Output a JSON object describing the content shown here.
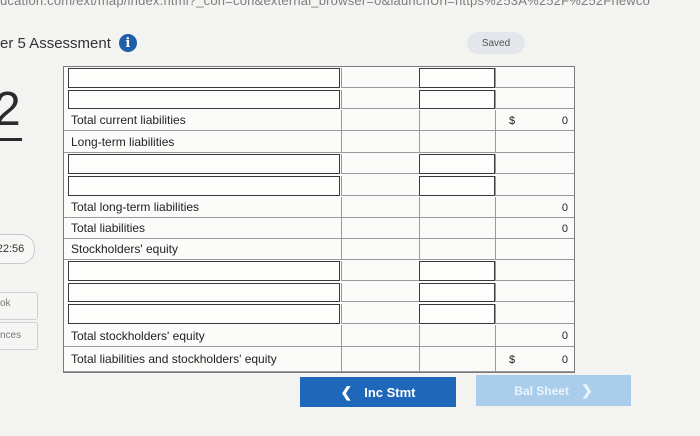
{
  "browser": {
    "url_fragment": "ucation.com/ext/map/index.html?_con=con&external_browser=0&launchUrl=https%253A%252F%252Fnewco"
  },
  "header": {
    "title": "er 5 Assessment",
    "saved_label": "Saved"
  },
  "sidebar": {
    "question_number": "2",
    "timer": "22:56",
    "book_label": "ok",
    "references_label": "nces"
  },
  "table": {
    "rows": [
      {
        "type": "input"
      },
      {
        "type": "input"
      },
      {
        "type": "label",
        "label": "Total current liabilities",
        "dollar": "$",
        "value": "0"
      },
      {
        "type": "label",
        "label": "Long-term liabilities",
        "dollar": "",
        "value": ""
      },
      {
        "type": "input"
      },
      {
        "type": "input"
      },
      {
        "type": "label",
        "label": "Total long-term liabilities",
        "dollar": "",
        "value": "0"
      },
      {
        "type": "label",
        "label": "Total liabilities",
        "dollar": "",
        "value": "0"
      },
      {
        "type": "label",
        "label": "Stockholders' equity",
        "dollar": "",
        "value": ""
      },
      {
        "type": "input"
      },
      {
        "type": "input"
      },
      {
        "type": "input"
      },
      {
        "type": "label",
        "label": "Total stockholders' equity",
        "dollar": "",
        "value": "0"
      },
      {
        "type": "label",
        "label": "Total liabilities and stockholders' equity",
        "dollar": "$",
        "value": "0"
      }
    ]
  },
  "nav": {
    "prev_label": "Inc Stmt",
    "next_label": "Bal Sheet"
  },
  "colors": {
    "primary_button": "#1f67b9",
    "disabled_button": "#a9cdeb",
    "info_icon": "#1f5fa8"
  }
}
